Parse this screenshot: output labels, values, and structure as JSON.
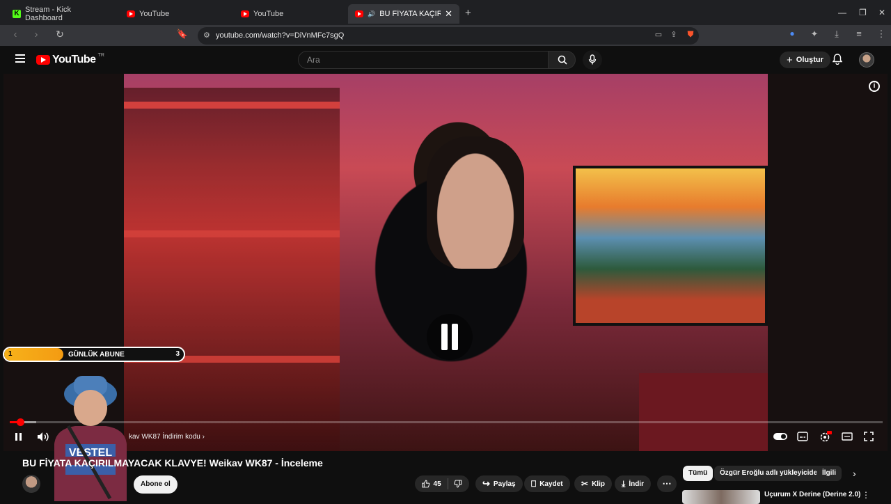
{
  "browser": {
    "tabs": [
      {
        "label": "Stream - Kick Dashboard",
        "active": false
      },
      {
        "label": "YouTube",
        "active": false
      },
      {
        "label": "YouTube",
        "active": false
      },
      {
        "label": "BU FİYATA KAÇIRILMAYACA",
        "active": true
      }
    ],
    "url": "youtube.com/watch?v=DiVnMFc7sgQ"
  },
  "youtube": {
    "logo_text": "YouTube",
    "logo_country": "TR",
    "search_placeholder": "Ara",
    "create_label": "Oluştur"
  },
  "player": {
    "progress_fraction": 0.012,
    "buffer_fraction": 0.03,
    "chapter_text": "kav WK87 İndirim kodu ›"
  },
  "overlay": {
    "goal_start": "1",
    "goal_label": "GÜNLÜK ABUNE",
    "goal_count": "3",
    "goal_fill_fraction": 0.33
  },
  "video": {
    "title": "BU FİYATA KAÇIRILMAYACAK KLAVYE! Weikav WK87 - İnceleme",
    "subscribe_label": "Abone ol",
    "like_count": "45",
    "share_label": "Paylaş",
    "save_label": "Kaydet",
    "clip_label": "Klip",
    "download_label": "İndir"
  },
  "chips": [
    {
      "label": "Tümü",
      "active": true
    },
    {
      "label": "Özgür Eroğlu adlı yükleyiciden",
      "active": false
    },
    {
      "label": "İlgili",
      "active": false
    }
  ],
  "recommendation": {
    "title": "Uçurum X Derine (Derine 2.0)"
  },
  "colors": {
    "yt_red": "#ff0000",
    "kick_green": "#53fc18",
    "goal_orange": "#f7b21a"
  }
}
